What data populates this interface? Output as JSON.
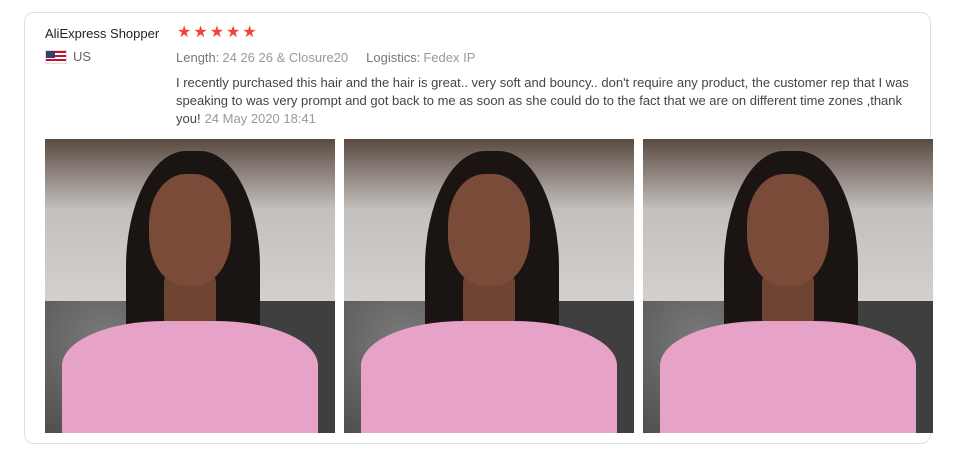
{
  "review": {
    "reviewer": "AliExpress Shopper",
    "country": "US",
    "rating": 5,
    "stars": [
      "★",
      "★",
      "★",
      "★",
      "★"
    ],
    "length_label": "Length:",
    "length_value": "24 26 26 & Closure20",
    "logistics_label": "Logistics:",
    "logistics_value": "Fedex IP",
    "text": "I recently purchased this hair and the hair is great.. very soft and bouncy.. don't require any product, the customer rep that I was speaking to was very prompt and got back to me as soon as she could do to the fact that we are on different time zones ,thank you!",
    "date": "24 May 2020 18:41",
    "photo_count": 3
  },
  "colors": {
    "star": "#f44336",
    "jacket": "#e7a2c8"
  }
}
